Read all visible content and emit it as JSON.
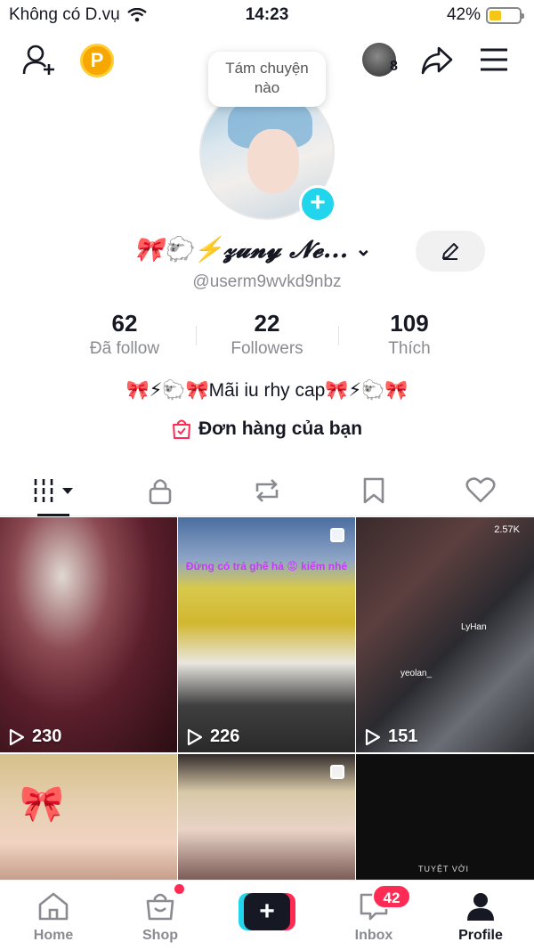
{
  "status_bar": {
    "carrier": "Không có D.vụ",
    "time": "14:23",
    "battery_text": "42%",
    "battery_level": 0.42
  },
  "header": {
    "coin_label": "P",
    "notification_count": "8"
  },
  "tooltip": {
    "line1": "Tám chuyện",
    "line2": "nào"
  },
  "profile": {
    "display_name": "🎀🐑⚡𝔃𝓾𝓷𝔂 𝓝𝓮...",
    "username": "@userm9wvkd9nbz",
    "bio": "🎀⚡🐑🎀Mãi iu rhy cap🎀⚡🐑🎀",
    "orders_label": "Đơn hàng của bạn"
  },
  "stats": [
    {
      "value": "62",
      "label": "Đã follow"
    },
    {
      "value": "22",
      "label": "Followers"
    },
    {
      "value": "109",
      "label": "Thích"
    }
  ],
  "videos": [
    {
      "views": "230"
    },
    {
      "views": "226",
      "overlay_text": "Đừng có trả ghế hả 😡 kiểm nhé"
    },
    {
      "views": "151",
      "live_count": "2.57K",
      "name_tag": "LyHan",
      "small_tag": "yeolan_"
    },
    {
      "views": ""
    },
    {
      "views": ""
    },
    {
      "views": "",
      "caption": "TUYỆT VỜI"
    }
  ],
  "nav": {
    "home": "Home",
    "shop": "Shop",
    "inbox": "Inbox",
    "profile": "Profile",
    "inbox_badge": "42"
  },
  "colors": {
    "accent_red": "#fe2c55",
    "accent_cyan": "#20d5ec",
    "coin": "#f7a800"
  }
}
